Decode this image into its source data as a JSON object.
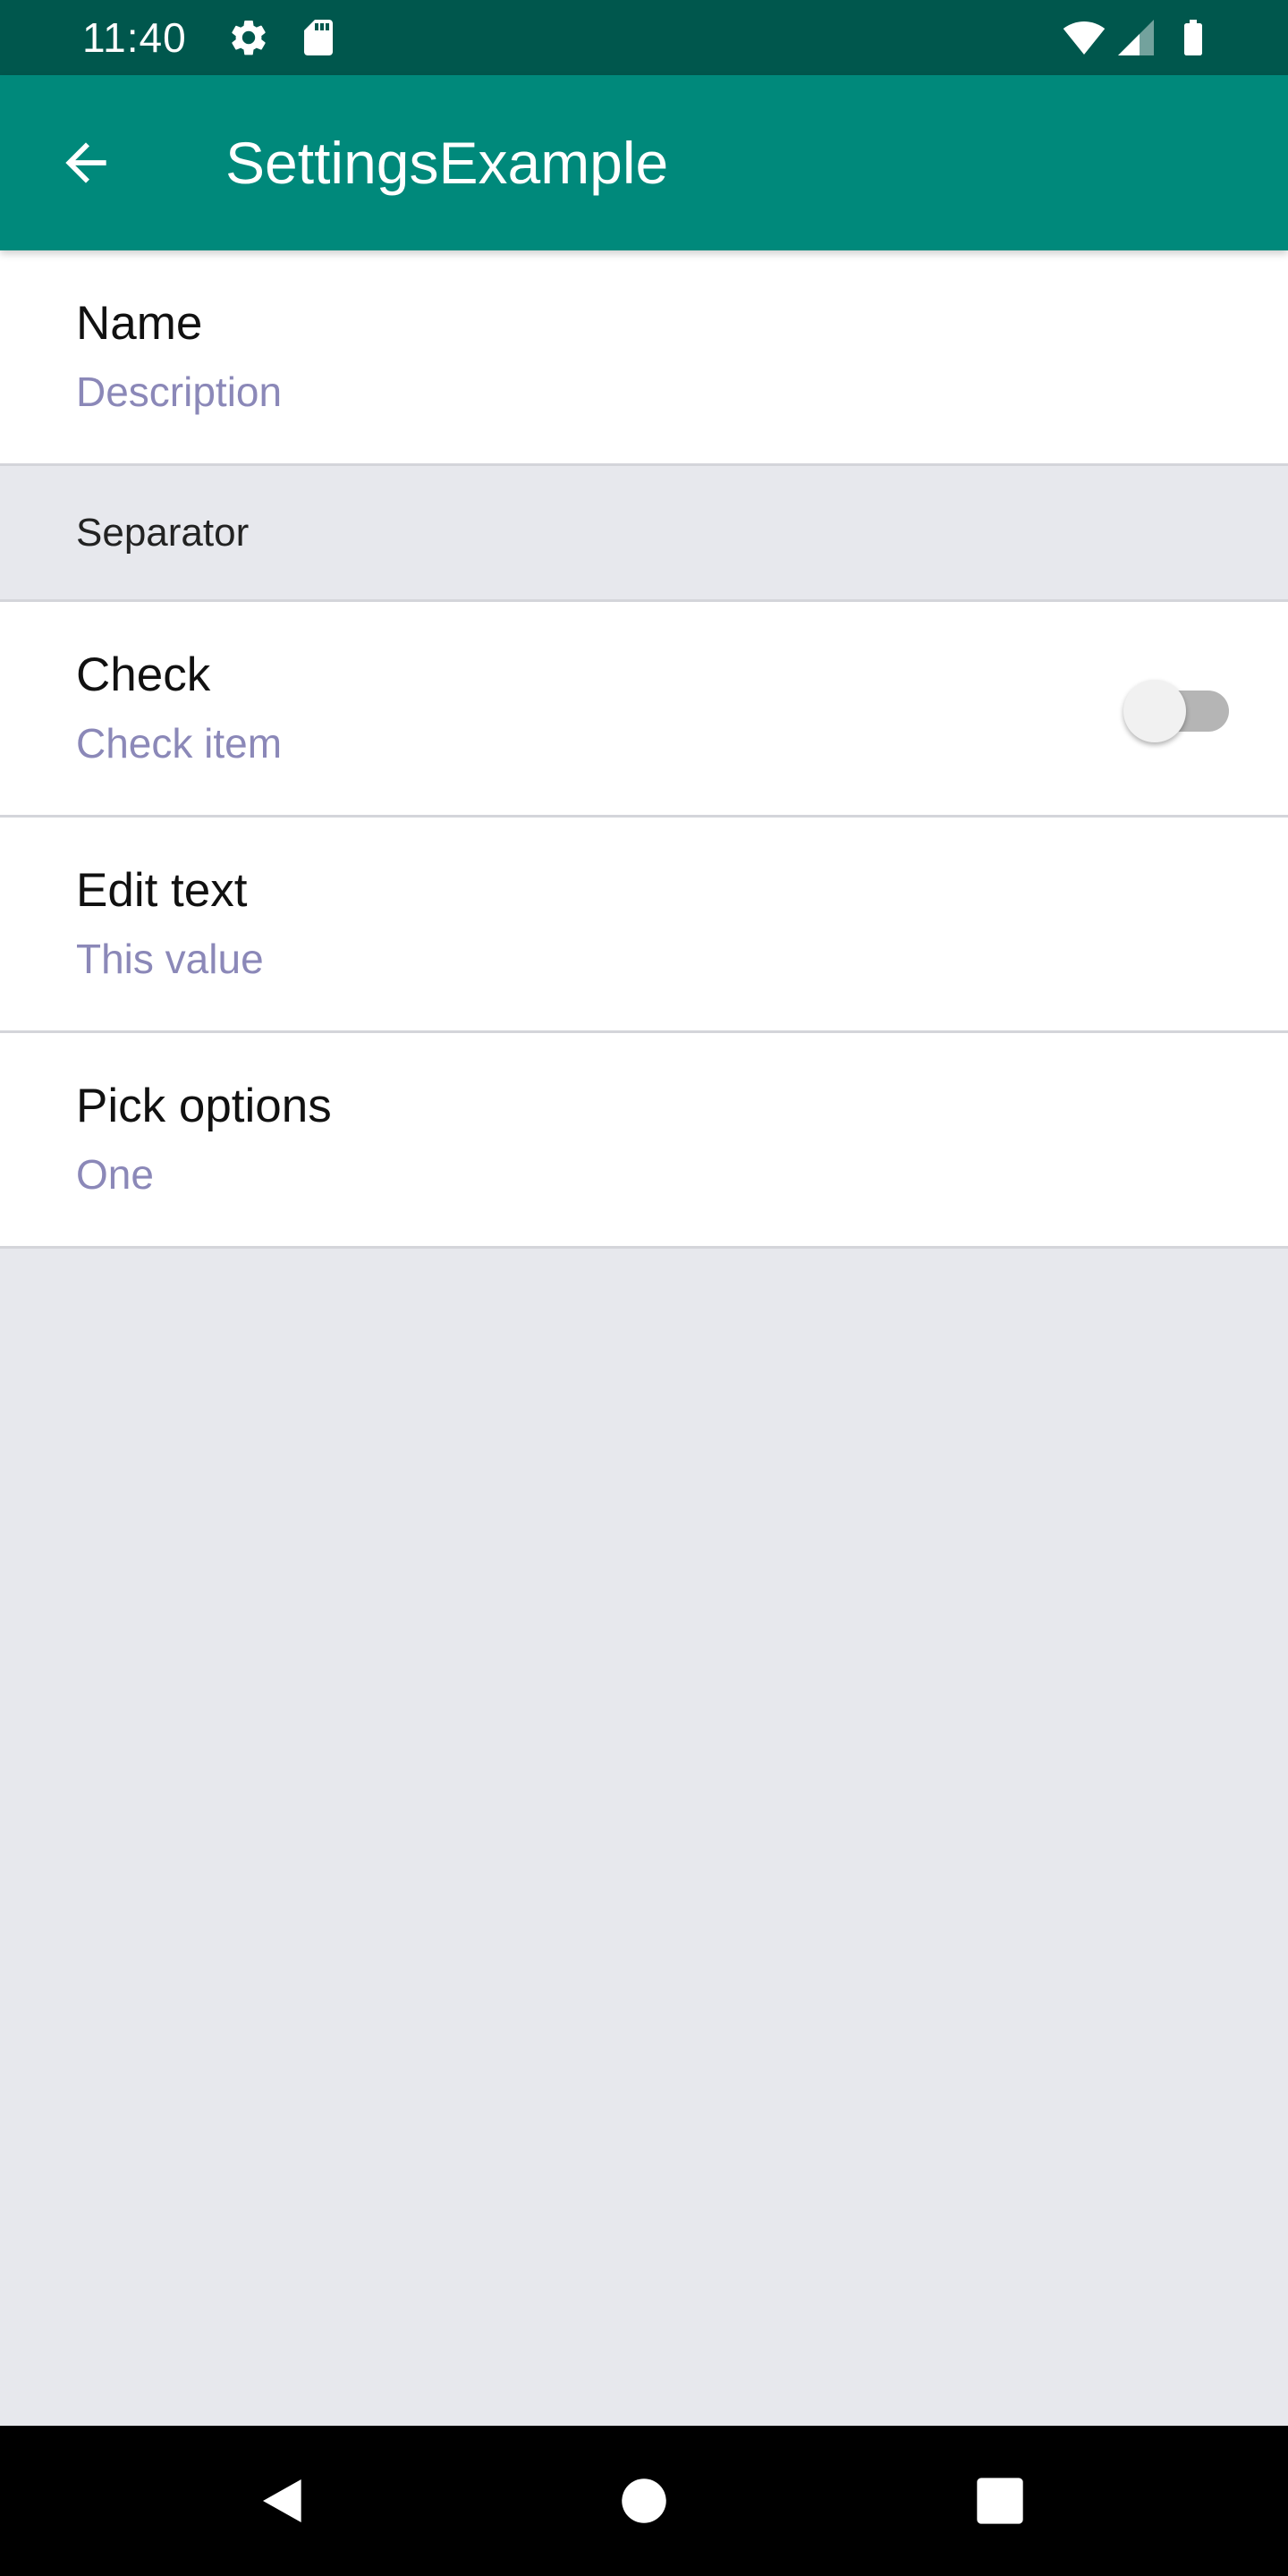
{
  "status_bar": {
    "time": "11:40",
    "icons": [
      "settings-icon",
      "sd-card-icon",
      "wifi-icon",
      "signal-icon",
      "battery-icon"
    ],
    "background": "#00574d"
  },
  "app_bar": {
    "title": "SettingsExample",
    "back_icon": "arrow-back-icon",
    "background": "#00897b"
  },
  "preferences": {
    "name": {
      "title": "Name",
      "summary": "Description"
    },
    "separator": {
      "label": "Separator"
    },
    "check": {
      "title": "Check",
      "summary": "Check item",
      "checked": false
    },
    "edit_text": {
      "title": "Edit text",
      "summary": "This value"
    },
    "pick_options": {
      "title": "Pick options",
      "summary": "One"
    }
  },
  "nav_bar": {
    "buttons": [
      "back-triangle-icon",
      "home-circle-icon",
      "recents-square-icon"
    ]
  },
  "colors": {
    "summary_text": "#8b88b8",
    "page_background": "#e7e8ed"
  }
}
